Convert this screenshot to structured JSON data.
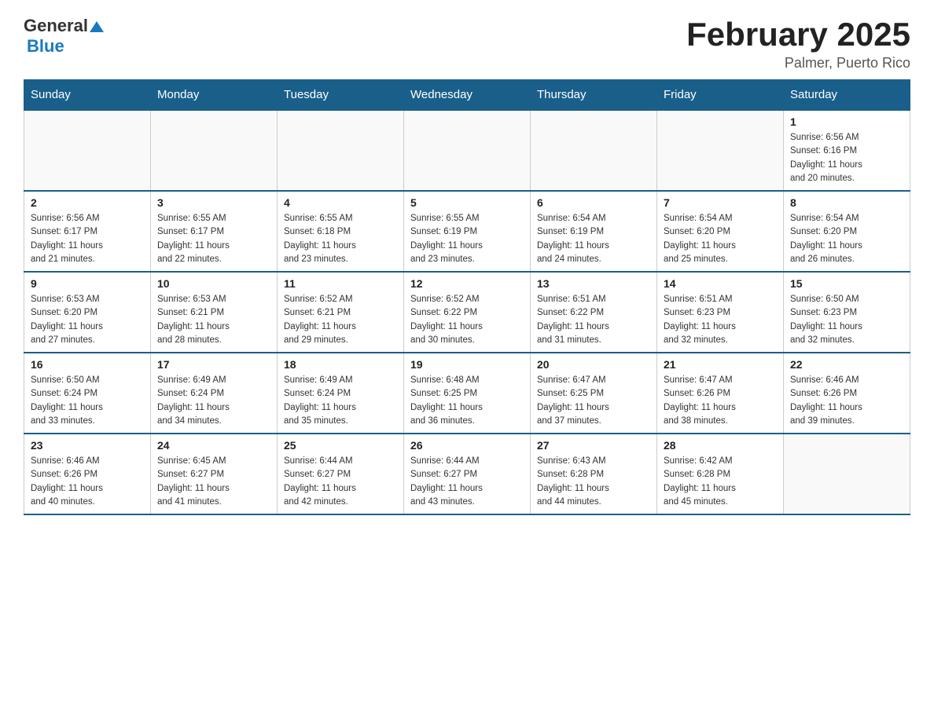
{
  "header": {
    "logo_general": "General",
    "logo_blue": "Blue",
    "month_title": "February 2025",
    "location": "Palmer, Puerto Rico"
  },
  "days_of_week": [
    "Sunday",
    "Monday",
    "Tuesday",
    "Wednesday",
    "Thursday",
    "Friday",
    "Saturday"
  ],
  "weeks": [
    [
      {
        "day": "",
        "info": ""
      },
      {
        "day": "",
        "info": ""
      },
      {
        "day": "",
        "info": ""
      },
      {
        "day": "",
        "info": ""
      },
      {
        "day": "",
        "info": ""
      },
      {
        "day": "",
        "info": ""
      },
      {
        "day": "1",
        "info": "Sunrise: 6:56 AM\nSunset: 6:16 PM\nDaylight: 11 hours\nand 20 minutes."
      }
    ],
    [
      {
        "day": "2",
        "info": "Sunrise: 6:56 AM\nSunset: 6:17 PM\nDaylight: 11 hours\nand 21 minutes."
      },
      {
        "day": "3",
        "info": "Sunrise: 6:55 AM\nSunset: 6:17 PM\nDaylight: 11 hours\nand 22 minutes."
      },
      {
        "day": "4",
        "info": "Sunrise: 6:55 AM\nSunset: 6:18 PM\nDaylight: 11 hours\nand 23 minutes."
      },
      {
        "day": "5",
        "info": "Sunrise: 6:55 AM\nSunset: 6:19 PM\nDaylight: 11 hours\nand 23 minutes."
      },
      {
        "day": "6",
        "info": "Sunrise: 6:54 AM\nSunset: 6:19 PM\nDaylight: 11 hours\nand 24 minutes."
      },
      {
        "day": "7",
        "info": "Sunrise: 6:54 AM\nSunset: 6:20 PM\nDaylight: 11 hours\nand 25 minutes."
      },
      {
        "day": "8",
        "info": "Sunrise: 6:54 AM\nSunset: 6:20 PM\nDaylight: 11 hours\nand 26 minutes."
      }
    ],
    [
      {
        "day": "9",
        "info": "Sunrise: 6:53 AM\nSunset: 6:20 PM\nDaylight: 11 hours\nand 27 minutes."
      },
      {
        "day": "10",
        "info": "Sunrise: 6:53 AM\nSunset: 6:21 PM\nDaylight: 11 hours\nand 28 minutes."
      },
      {
        "day": "11",
        "info": "Sunrise: 6:52 AM\nSunset: 6:21 PM\nDaylight: 11 hours\nand 29 minutes."
      },
      {
        "day": "12",
        "info": "Sunrise: 6:52 AM\nSunset: 6:22 PM\nDaylight: 11 hours\nand 30 minutes."
      },
      {
        "day": "13",
        "info": "Sunrise: 6:51 AM\nSunset: 6:22 PM\nDaylight: 11 hours\nand 31 minutes."
      },
      {
        "day": "14",
        "info": "Sunrise: 6:51 AM\nSunset: 6:23 PM\nDaylight: 11 hours\nand 32 minutes."
      },
      {
        "day": "15",
        "info": "Sunrise: 6:50 AM\nSunset: 6:23 PM\nDaylight: 11 hours\nand 32 minutes."
      }
    ],
    [
      {
        "day": "16",
        "info": "Sunrise: 6:50 AM\nSunset: 6:24 PM\nDaylight: 11 hours\nand 33 minutes."
      },
      {
        "day": "17",
        "info": "Sunrise: 6:49 AM\nSunset: 6:24 PM\nDaylight: 11 hours\nand 34 minutes."
      },
      {
        "day": "18",
        "info": "Sunrise: 6:49 AM\nSunset: 6:24 PM\nDaylight: 11 hours\nand 35 minutes."
      },
      {
        "day": "19",
        "info": "Sunrise: 6:48 AM\nSunset: 6:25 PM\nDaylight: 11 hours\nand 36 minutes."
      },
      {
        "day": "20",
        "info": "Sunrise: 6:47 AM\nSunset: 6:25 PM\nDaylight: 11 hours\nand 37 minutes."
      },
      {
        "day": "21",
        "info": "Sunrise: 6:47 AM\nSunset: 6:26 PM\nDaylight: 11 hours\nand 38 minutes."
      },
      {
        "day": "22",
        "info": "Sunrise: 6:46 AM\nSunset: 6:26 PM\nDaylight: 11 hours\nand 39 minutes."
      }
    ],
    [
      {
        "day": "23",
        "info": "Sunrise: 6:46 AM\nSunset: 6:26 PM\nDaylight: 11 hours\nand 40 minutes."
      },
      {
        "day": "24",
        "info": "Sunrise: 6:45 AM\nSunset: 6:27 PM\nDaylight: 11 hours\nand 41 minutes."
      },
      {
        "day": "25",
        "info": "Sunrise: 6:44 AM\nSunset: 6:27 PM\nDaylight: 11 hours\nand 42 minutes."
      },
      {
        "day": "26",
        "info": "Sunrise: 6:44 AM\nSunset: 6:27 PM\nDaylight: 11 hours\nand 43 minutes."
      },
      {
        "day": "27",
        "info": "Sunrise: 6:43 AM\nSunset: 6:28 PM\nDaylight: 11 hours\nand 44 minutes."
      },
      {
        "day": "28",
        "info": "Sunrise: 6:42 AM\nSunset: 6:28 PM\nDaylight: 11 hours\nand 45 minutes."
      },
      {
        "day": "",
        "info": ""
      }
    ]
  ]
}
